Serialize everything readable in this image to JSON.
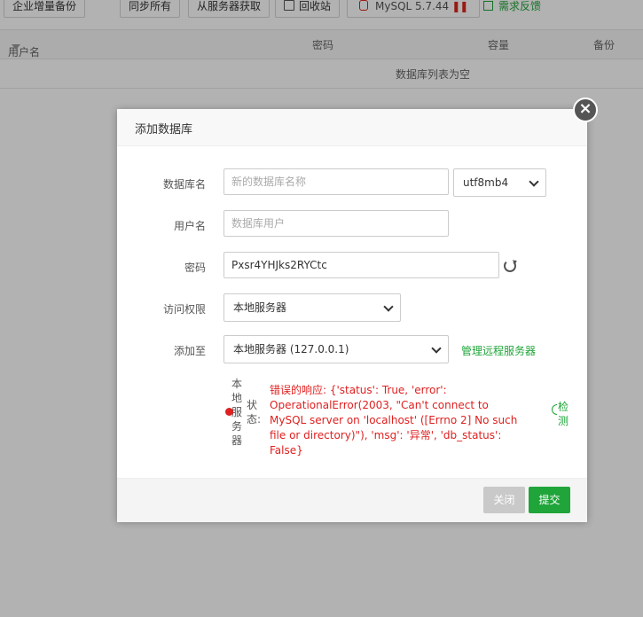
{
  "toolbar": {
    "enterprise_backup": "企业增量备份",
    "sync_all": "同步所有",
    "fetch_from_server": "从服务器获取",
    "recycle_bin": "回收站",
    "mysql_version": "MySQL 5.7.44",
    "feedback": "需求反馈"
  },
  "table": {
    "headers": [
      "用户名",
      "密码",
      "容量",
      "备份"
    ],
    "empty_text": "数据库列表为空"
  },
  "dialog": {
    "title": "添加数据库",
    "db_name_label": "数据库名",
    "db_name_placeholder": "新的数据库名称",
    "charset_value": "utf8mb4",
    "username_label": "用户名",
    "username_placeholder": "数据库用户",
    "password_label": "密码",
    "password_value": "Pxsr4YHJks2RYCtc",
    "access_label": "访问权限",
    "access_value": "本地服务器",
    "add_to_label": "添加至",
    "add_to_value": "本地服务器 (127.0.0.1)",
    "manage_remote": "管理远程服务器",
    "server_name": "本地服务器",
    "status_label": "状态:",
    "error_message": "错误的响应: {'status': True, 'error': OperationalError(2003, \"Can't connect to MySQL server on 'localhost' ([Errno 2] No such file or directory)\"), 'msg': '异常', 'db_status': False}",
    "detect": "检测",
    "close_button": "关闭",
    "submit_button": "提交"
  },
  "colors": {
    "accent": "#20a53a",
    "error": "#e02020"
  }
}
